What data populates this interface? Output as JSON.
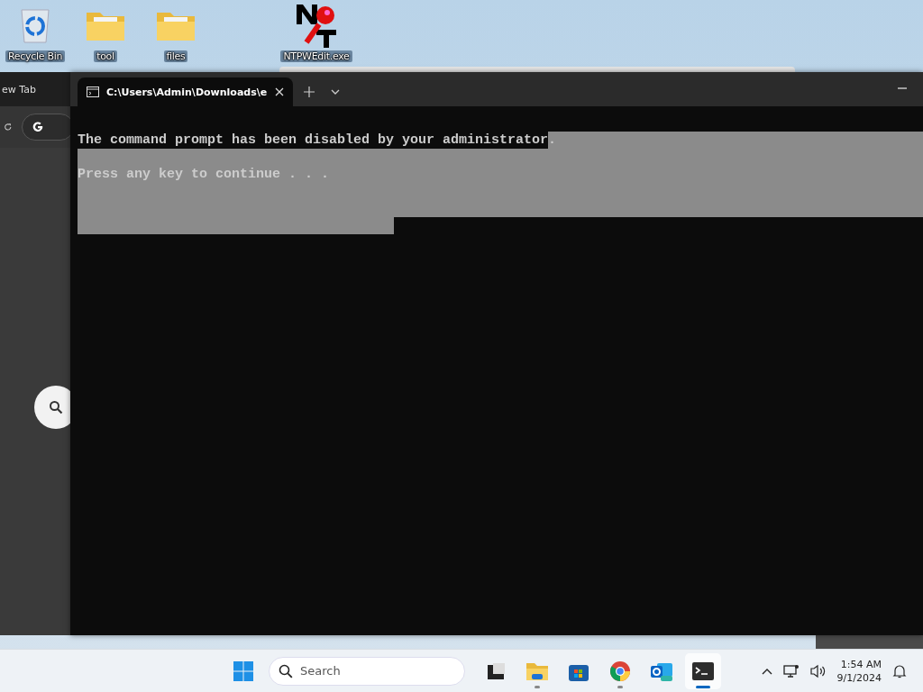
{
  "desktop_icons": [
    {
      "label": "Recycle Bin",
      "kind": "recycle"
    },
    {
      "label": "tool",
      "kind": "folder"
    },
    {
      "label": "files",
      "kind": "folder"
    },
    {
      "label": "NTPWEdit.exe",
      "kind": "app"
    }
  ],
  "browser_window": {
    "tab_title": "ew Tab"
  },
  "terminal": {
    "tabs": [
      {
        "title": "C:\\Users\\Admin\\Downloads\\e",
        "selected": true
      }
    ],
    "lines": [
      {
        "text": "The command prompt has been disabled by your administrator.",
        "selected": true,
        "kind": "tail"
      },
      {
        "selected": true,
        "kind": "full"
      },
      {
        "text": "Press any key to continue . . .",
        "selected": true,
        "kind": "full"
      },
      {
        "selected": true,
        "kind": "full"
      },
      {
        "selected": true,
        "kind": "full"
      },
      {
        "selected": true,
        "kind": "head"
      }
    ]
  },
  "taskbar": {
    "search": {
      "placeholder": "Search"
    },
    "apps": [
      {
        "kind": "window",
        "running": false,
        "selected": false
      },
      {
        "kind": "folder",
        "running": true,
        "selected": false
      },
      {
        "kind": "store",
        "running": false,
        "selected": false
      },
      {
        "kind": "chrome",
        "running": true,
        "selected": false
      },
      {
        "kind": "outlook",
        "running": false,
        "selected": false
      },
      {
        "kind": "terminal",
        "running": true,
        "selected": true
      }
    ],
    "time": "1:54 AM",
    "date": "9/1/2024"
  }
}
